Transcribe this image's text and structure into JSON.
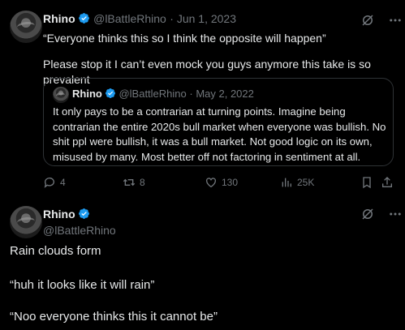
{
  "tweet": {
    "author_name": "Rhino",
    "author_handle": "@lBattleRhino",
    "date": "· Jun 1, 2023",
    "line1": "“Everyone thinks this so I think the opposite will happen”",
    "line2": "Please stop it I can’t even mock you guys anymore this take is so prevalent",
    "quote": {
      "author_name": "Rhino",
      "author_handle": "@lBattleRhino",
      "date": "· May 2, 2022",
      "text": "It only pays to be a contrarian at turning points. Imagine being contrarian the entire 2020s bull market when everyone was bullish. No shit ppl were bullish, it was a bull market. Not good logic on its own, misused by many. Most better off not factoring in sentiment at all."
    },
    "actions": {
      "replies": "4",
      "retweets": "8",
      "likes": "130",
      "views": "25K"
    }
  },
  "reply": {
    "author_name": "Rhino",
    "author_handle": "@lBattleRhino",
    "line1": "Rain clouds form",
    "line2": "“huh it looks like it will rain”",
    "line3": "“Noo everyone thinks this it cannot be”"
  },
  "colors": {
    "background": "#000000",
    "text": "#e7e9ea",
    "muted": "#71767b",
    "verified": "#1d9bf0",
    "border": "#2f3336"
  },
  "icons": [
    "verified-badge-icon",
    "grok-icon",
    "more-icon",
    "reply-icon",
    "retweet-icon",
    "like-icon",
    "views-icon",
    "bookmark-icon",
    "share-icon"
  ]
}
